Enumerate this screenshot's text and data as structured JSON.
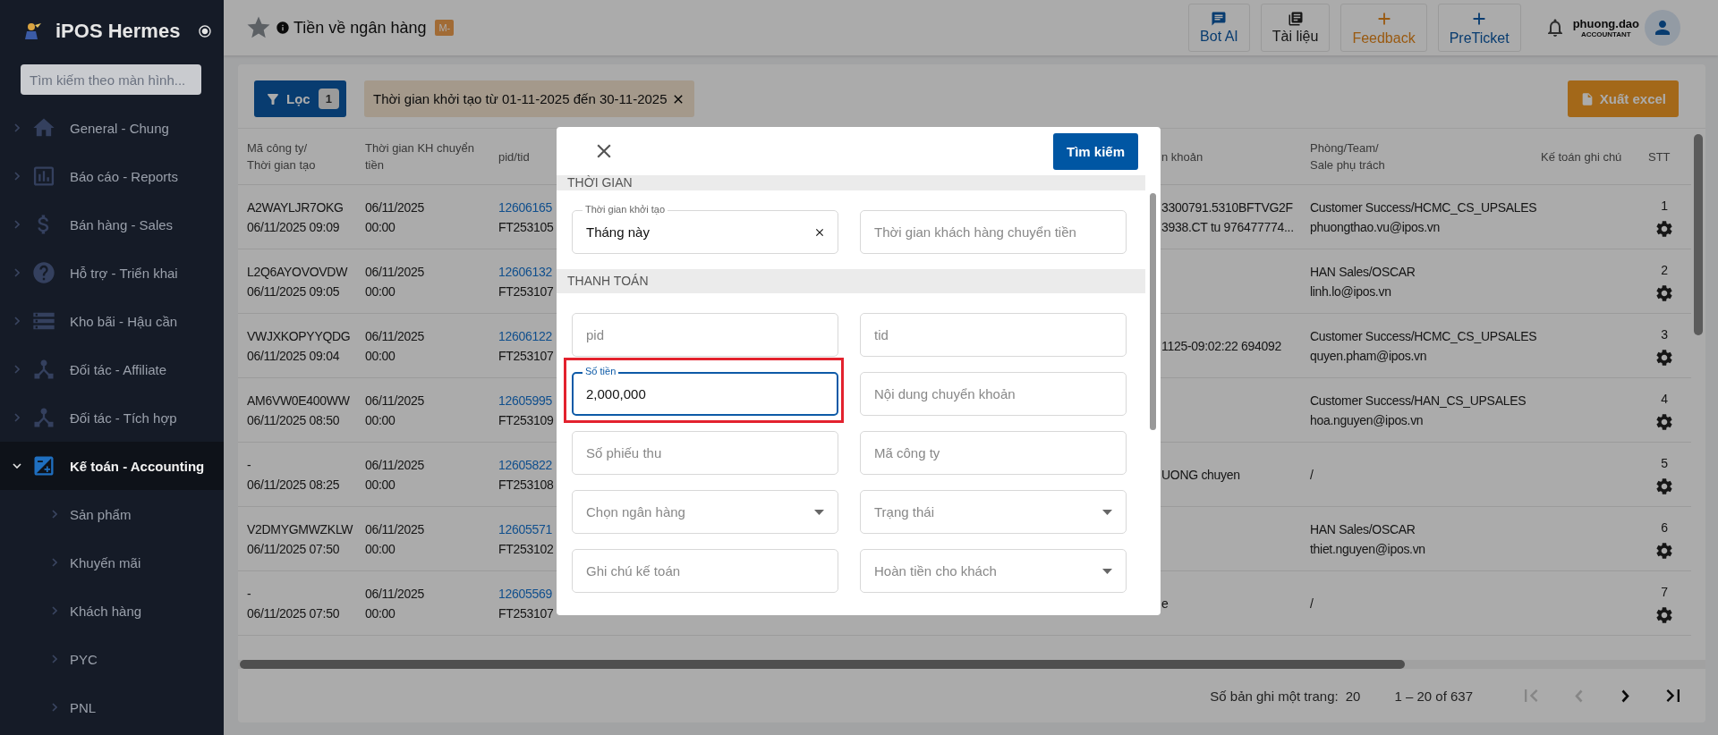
{
  "sidebar": {
    "title": "iPOS Hermes",
    "search": {
      "placeholder": "Tìm kiếm theo màn hình..."
    },
    "items": [
      {
        "label": "General - Chung",
        "expanded": false,
        "selected": false
      },
      {
        "label": "Báo cáo - Reports",
        "expanded": false,
        "selected": false
      },
      {
        "label": "Bán hàng - Sales",
        "expanded": false,
        "selected": false
      },
      {
        "label": "Hỗ trợ - Triển khai",
        "expanded": false,
        "selected": false
      },
      {
        "label": "Kho bãi - Hậu cần",
        "expanded": false,
        "selected": false
      },
      {
        "label": "Đối tác - Affiliate",
        "expanded": false,
        "selected": false
      },
      {
        "label": "Đối tác - Tích hợp",
        "expanded": false,
        "selected": false
      },
      {
        "label": "Kế toán - Accounting",
        "expanded": true,
        "selected": true,
        "children": [
          {
            "label": "Sản phẩm"
          },
          {
            "label": "Khuyến mãi"
          },
          {
            "label": "Khách hàng"
          },
          {
            "label": "PYC"
          },
          {
            "label": "PNL"
          }
        ]
      }
    ]
  },
  "header": {
    "title": "Tiền về ngân hàng",
    "badge": "M-",
    "actions": [
      {
        "label": "Bot AI"
      },
      {
        "label": "Tài liệu"
      },
      {
        "label": "Feedback"
      },
      {
        "label": "PreTicket"
      }
    ],
    "user": {
      "name": "phuong.dao",
      "role": "ACCOUNTANT"
    }
  },
  "toolbar": {
    "filter": {
      "label": "Lọc",
      "count": "1"
    },
    "chips": [
      {
        "label": "Thời gian khởi tạo từ 01-11-2025 đến 30-11-2025"
      }
    ],
    "export": {
      "label": "Xuất excel"
    }
  },
  "table": {
    "columns": [
      "Mã công ty/\nThời gian tạo",
      "Thời gian KH chuyển tiền",
      "pid/tid",
      "n khoản",
      "Phòng/Team/\nSale phụ trách",
      "Kế toán ghi chú",
      "STT"
    ],
    "rows": [
      {
        "code": "A2WAYLJR7OKG",
        "created": "06/11/2025 09:09",
        "transfer_date": "06/11/2025",
        "transfer_time": "00:00",
        "pid": "12606165",
        "tid": "FT253105",
        "content": [
          "3300791.5310BFTVG2F",
          "3938.CT tu 976477774..."
        ],
        "team": "Customer Success/HCMC_CS_UPSALES",
        "sale": "phuongthao.vu@ipos.vn",
        "stt": "1"
      },
      {
        "code": "L2Q6AYOVOVDW",
        "created": "06/11/2025 09:05",
        "transfer_date": "06/11/2025",
        "transfer_time": "00:00",
        "pid": "12606132",
        "tid": "FT253107",
        "team": "HAN Sales/OSCAR",
        "sale": "linh.lo@ipos.vn",
        "stt": "2"
      },
      {
        "code": "VWJXKOPYYQDG",
        "created": "06/11/2025 09:04",
        "transfer_date": "06/11/2025",
        "transfer_time": "00:00",
        "pid": "12606122",
        "tid": "FT253107",
        "content": [
          "1125-09:02:22 694092"
        ],
        "team": "Customer Success/HCMC_CS_UPSALES",
        "sale": "quyen.pham@ipos.vn",
        "stt": "3"
      },
      {
        "code": "AM6VW0E400WW",
        "created": "06/11/2025 08:50",
        "transfer_date": "06/11/2025",
        "transfer_time": "00:00",
        "pid": "12605995",
        "tid": "FT253109",
        "team": "Customer Success/HAN_CS_UPSALES",
        "sale": "hoa.nguyen@ipos.vn",
        "stt": "4"
      },
      {
        "code": "-",
        "created": "06/11/2025 08:25",
        "transfer_date": "06/11/2025",
        "transfer_time": "00:00",
        "pid": "12605822",
        "tid": "FT253108",
        "content": [
          "UONG chuyen"
        ],
        "team": "/",
        "stt": "5"
      },
      {
        "code": "V2DMYGMWZKLW",
        "created": "06/11/2025 07:50",
        "transfer_date": "06/11/2025",
        "transfer_time": "00:00",
        "pid": "12605571",
        "tid": "FT253102",
        "team": "HAN Sales/OSCAR",
        "sale": "thiet.nguyen@ipos.vn",
        "stt": "6"
      },
      {
        "code": "-",
        "created": "06/11/2025 07:50",
        "transfer_date": "06/11/2025",
        "transfer_time": "00:00",
        "pid": "12605569",
        "tid": "FT253107",
        "content": [
          "e"
        ],
        "team": "/",
        "stt": "7"
      }
    ]
  },
  "pagination": {
    "rows_label": "Số bản ghi một trang:",
    "rows_value": "20",
    "range": "1 – 20 of 637",
    "nav": [
      {
        "disabled": true
      },
      {
        "disabled": true
      },
      {
        "disabled": false
      },
      {
        "disabled": false
      }
    ]
  },
  "modal": {
    "search_button": "Tìm kiếm",
    "sections": [
      {
        "title": "THỜI GIAN",
        "fields": [
          {
            "kind": "clearable",
            "label": "Thời gian khởi tạo",
            "value": "Tháng này",
            "focused": false
          },
          {
            "kind": "text",
            "placeholder": "Thời gian khách hàng chuyển tiền",
            "focused": false
          }
        ]
      },
      {
        "title": "THANH TOÁN",
        "fields": [
          {
            "kind": "text",
            "placeholder": "pid",
            "focused": false
          },
          {
            "kind": "text",
            "placeholder": "tid",
            "focused": false
          },
          {
            "kind": "text",
            "label": "Số tiền",
            "value": "2,000,000",
            "focused": true
          },
          {
            "kind": "text",
            "placeholder": "Nội dung chuyển khoản",
            "focused": false
          },
          {
            "kind": "text",
            "placeholder": "Số phiếu thu",
            "focused": false
          },
          {
            "kind": "text",
            "placeholder": "Mã công ty",
            "focused": false
          },
          {
            "kind": "select",
            "placeholder": "Chọn ngân hàng",
            "focused": false
          },
          {
            "kind": "select",
            "placeholder": "Trạng thái",
            "focused": false
          },
          {
            "kind": "text",
            "placeholder": "Ghi chú kế toán",
            "focused": false
          },
          {
            "kind": "select",
            "placeholder": "Hoàn tiền cho khách",
            "focused": false
          }
        ]
      }
    ]
  }
}
